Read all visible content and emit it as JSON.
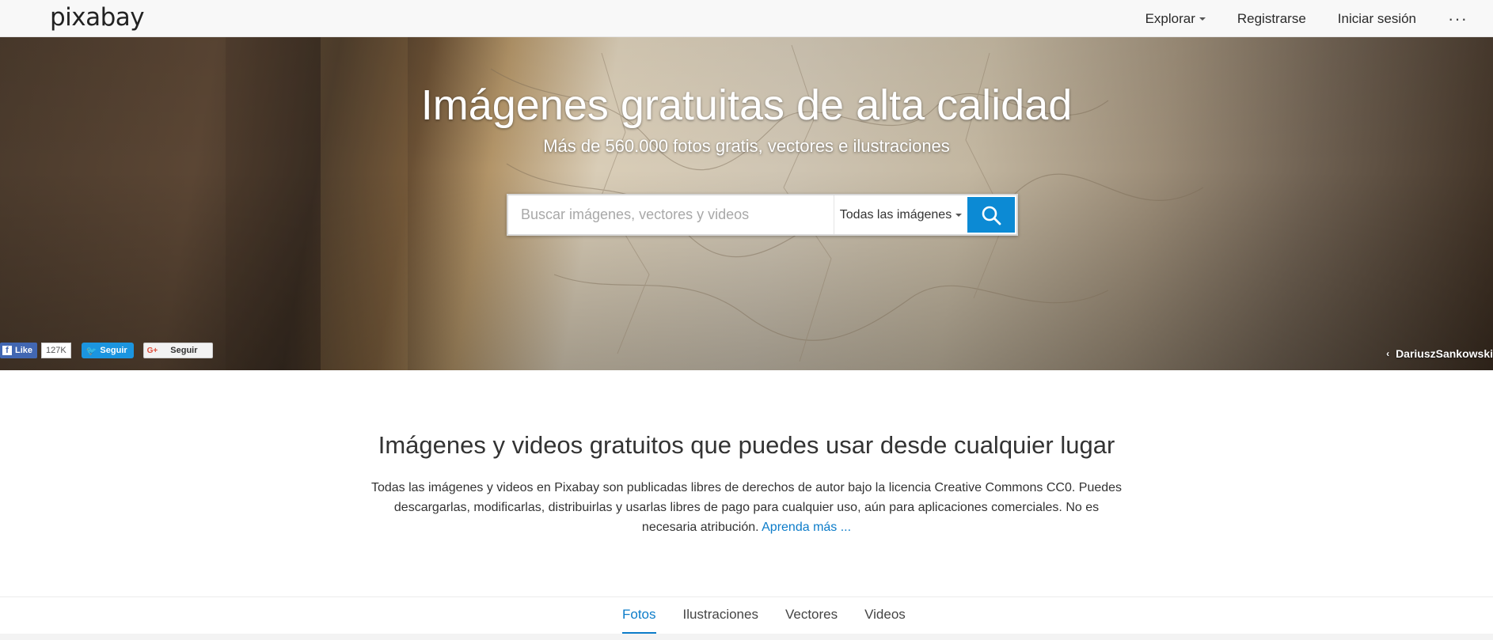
{
  "nav": {
    "logo": "pixabay",
    "explore": "Explorar",
    "register": "Registrarse",
    "login": "Iniciar sesión",
    "more": "···"
  },
  "hero": {
    "title": "Imágenes gratuitas de alta calidad",
    "subtitle": "Más de 560.000 fotos gratis, vectores e ilustraciones",
    "search": {
      "placeholder": "Buscar imágenes, vectores y videos",
      "value": "",
      "type_selected": "Todas las imágenes",
      "button_icon": "search-icon"
    },
    "social": {
      "facebook_label": "Like",
      "facebook_count": "127K",
      "twitter_label": "Seguir",
      "google_label": "Seguir"
    },
    "credit": "DariuszSankowski"
  },
  "intro": {
    "title": "Imágenes y videos gratuitos que puedes usar desde cualquier lugar",
    "text": "Todas las imágenes y videos en Pixabay son publicadas libres de derechos de autor bajo la licencia Creative Commons CC0. Puedes descargarlas, modificarlas, distribuirlas y usarlas libres de pago para cualquier uso, aún para aplicaciones comerciales. No es necesaria atribución.",
    "learn_more": "Aprenda más ..."
  },
  "tabs": [
    {
      "label": "Fotos",
      "active": true
    },
    {
      "label": "Ilustraciones",
      "active": false
    },
    {
      "label": "Vectores",
      "active": false
    },
    {
      "label": "Videos",
      "active": false
    }
  ],
  "colors": {
    "accent": "#0c7cc9",
    "search_button": "#0c8ad4"
  }
}
